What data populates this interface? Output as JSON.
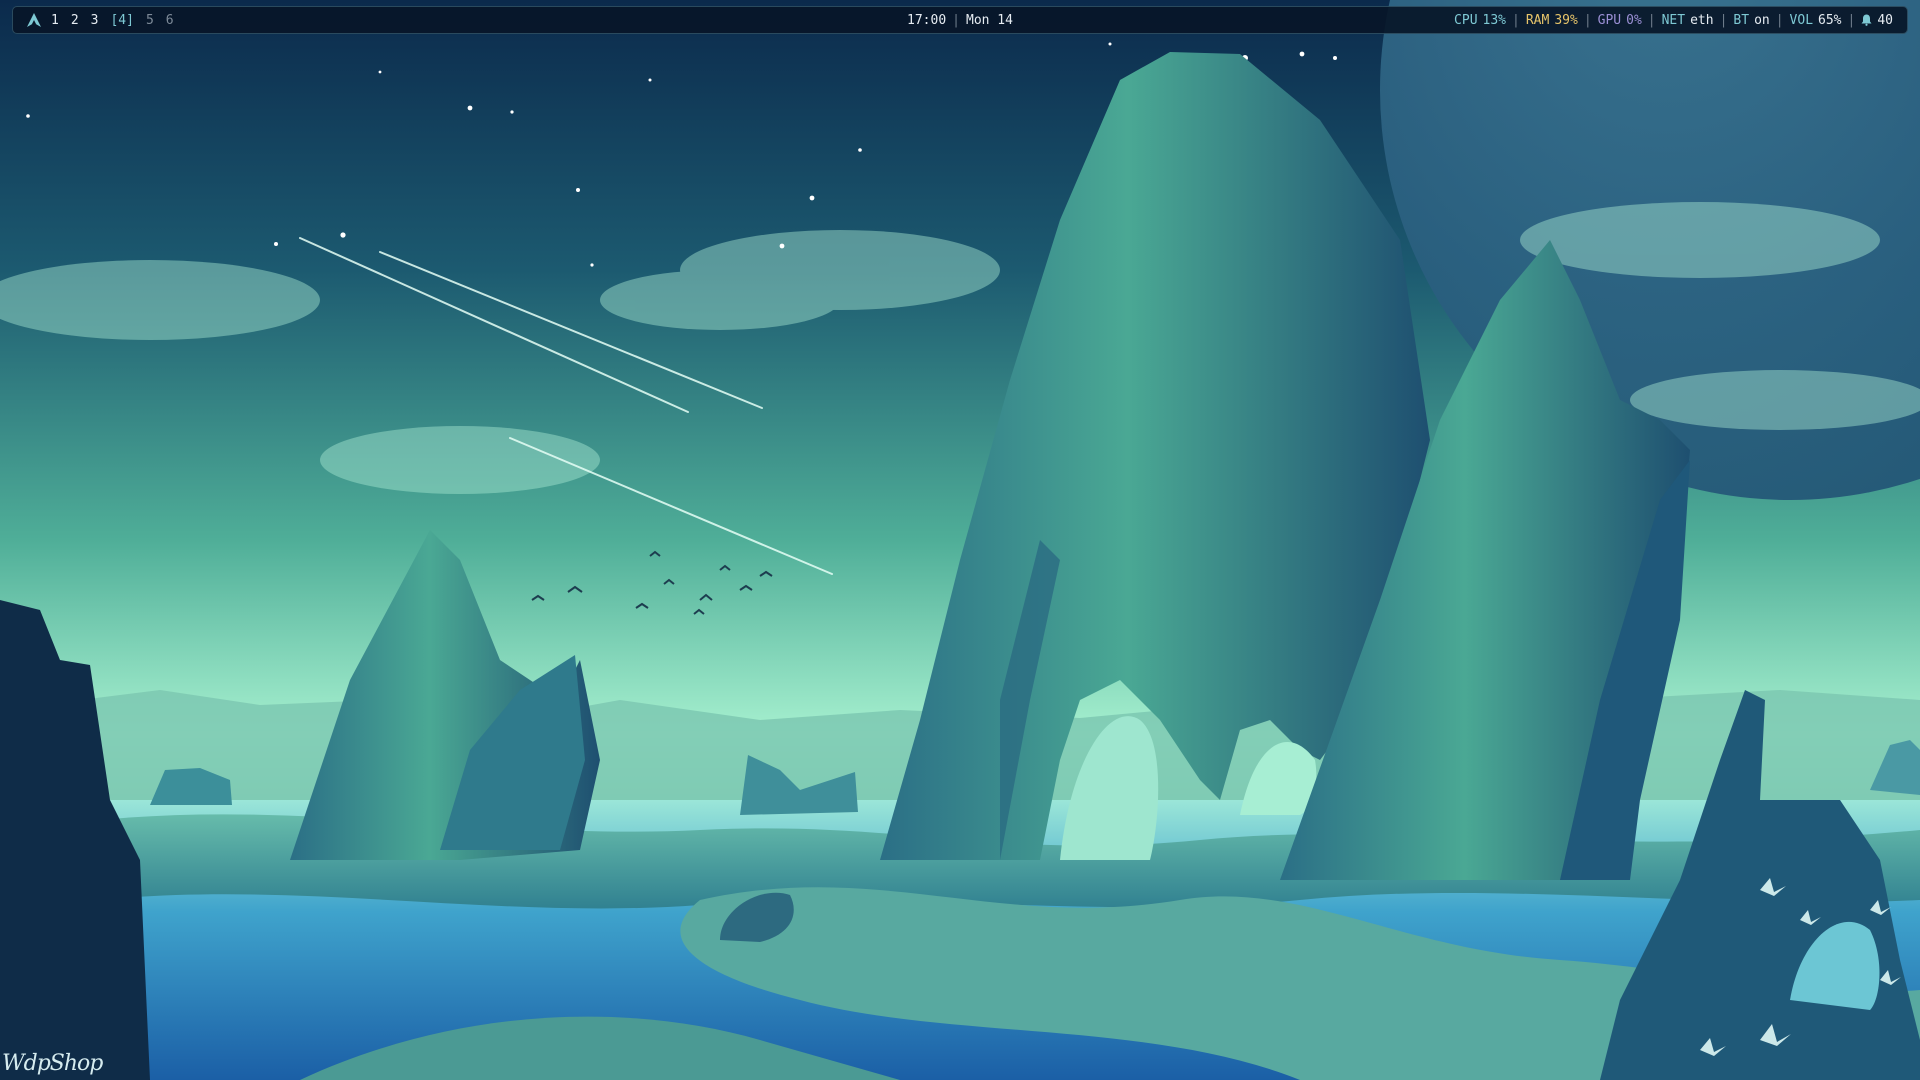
{
  "topbar": {
    "workspaces": [
      {
        "label": "1",
        "state": "normal"
      },
      {
        "label": "2",
        "state": "normal"
      },
      {
        "label": "3",
        "state": "normal"
      },
      {
        "label": "[4]",
        "state": "active"
      },
      {
        "label": "5",
        "state": "dim"
      },
      {
        "label": "6",
        "state": "dim"
      }
    ],
    "clock": "17:00",
    "separator": "|",
    "date": "Mon 14",
    "status": {
      "cpu": {
        "label": "CPU",
        "value": "13%",
        "color": "#7ec9d4"
      },
      "ram": {
        "label": "RAM",
        "value": "39%",
        "color": "#e6c46a"
      },
      "gpu": {
        "label": "GPU",
        "value": "0%",
        "color": "#9a8fd4"
      },
      "net": {
        "label": "NET",
        "value": "eth",
        "color": "#7ec9d4"
      },
      "bt": {
        "label": "BT",
        "value": "on",
        "color": "#7ec9d4"
      },
      "vol": {
        "label": "VOL",
        "value": "65%",
        "color": "#7ec9d4"
      },
      "notifications": {
        "icon": "bell-icon",
        "count": "40"
      }
    }
  },
  "desktop": {
    "wallpaper": "alien coastal landscape with rock arches and a large planet",
    "signature": "WdpShop"
  },
  "colors": {
    "bar_bg": "#081628",
    "accent": "#7ec9d4",
    "sky_top": "#0d2f52",
    "sky_glow": "#8fe6c4",
    "water": "#2e88c8",
    "rock": "#3f9a8e"
  }
}
